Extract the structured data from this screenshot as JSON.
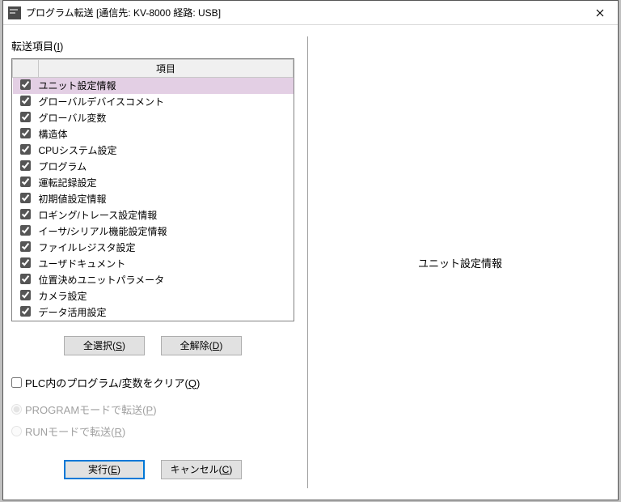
{
  "window": {
    "title": "プログラム転送 [通信先: KV-8000 経路: USB]"
  },
  "left": {
    "section_label_pre": "転送項目(",
    "section_label_u": "I",
    "section_label_post": ")",
    "header_chk": "",
    "header_item": "項目",
    "items": [
      {
        "checked": true,
        "label": "ユニット設定情報",
        "selected": true
      },
      {
        "checked": true,
        "label": "グローバルデバイスコメント"
      },
      {
        "checked": true,
        "label": "グローバル変数"
      },
      {
        "checked": true,
        "label": "構造体"
      },
      {
        "checked": true,
        "label": "CPUシステム設定"
      },
      {
        "checked": true,
        "label": "プログラム"
      },
      {
        "checked": true,
        "label": "運転記録設定"
      },
      {
        "checked": true,
        "label": "初期値設定情報"
      },
      {
        "checked": true,
        "label": "ロギング/トレース設定情報"
      },
      {
        "checked": true,
        "label": "イーサ/シリアル機能設定情報"
      },
      {
        "checked": true,
        "label": "ファイルレジスタ設定"
      },
      {
        "checked": true,
        "label": "ユーザドキュメント"
      },
      {
        "checked": true,
        "label": "位置決めユニットパラメータ"
      },
      {
        "checked": true,
        "label": "カメラ設定"
      },
      {
        "checked": true,
        "label": "データ活用設定"
      }
    ],
    "select_all_pre": "全選択(",
    "select_all_u": "S",
    "select_all_post": ")",
    "deselect_all_pre": "全解除(",
    "deselect_all_u": "D",
    "deselect_all_post": ")",
    "clear_label_pre": "PLC内のプログラム/変数をクリア(",
    "clear_label_u": "Q",
    "clear_label_post": ")",
    "radio_program_pre": "PROGRAMモードで転送(",
    "radio_program_u": "P",
    "radio_program_post": ")",
    "radio_run_pre": "RUNモードで転送(",
    "radio_run_u": "R",
    "radio_run_post": ")",
    "execute_pre": "実行(",
    "execute_u": "E",
    "execute_post": ")",
    "cancel_pre": "キャンセル(",
    "cancel_u": "C",
    "cancel_post": ")"
  },
  "right": {
    "detail_text": "ユニット設定情報"
  }
}
